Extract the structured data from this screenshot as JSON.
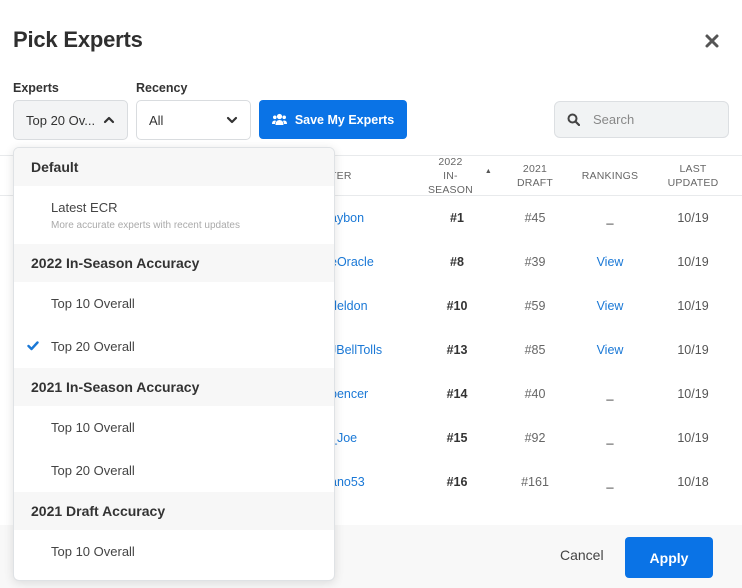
{
  "modal": {
    "title": "Pick Experts",
    "close_icon": "close-icon"
  },
  "filters": {
    "experts_label": "Experts",
    "experts_value": "Top 20 Ov...",
    "recency_label": "Recency",
    "recency_value": "All",
    "save_label": "Save My Experts",
    "search_placeholder": "Search"
  },
  "table": {
    "headers": {
      "name": "TER",
      "insea": [
        "2022",
        "IN-SEASON"
      ],
      "draft": [
        "2021",
        "DRAFT"
      ],
      "rankings": "RANKINGS",
      "updated": [
        "LAST",
        "UPDATED"
      ]
    },
    "rows": [
      {
        "name": "aybon",
        "insea": "#1",
        "draft": "#45",
        "rankings": "_",
        "updated": "10/19"
      },
      {
        "name": "eOracle",
        "insea": "#8",
        "draft": "#39",
        "rankings": "View",
        "updated": "10/19"
      },
      {
        "name": "deldon",
        "insea": "#10",
        "draft": "#59",
        "rankings": "View",
        "updated": "10/19"
      },
      {
        "name": "JBellTolls",
        "insea": "#13",
        "draft": "#85",
        "rankings": "View",
        "updated": "10/19"
      },
      {
        "name": "pencer",
        "insea": "#14",
        "draft": "#40",
        "rankings": "_",
        "updated": "10/19"
      },
      {
        "name": "_Joe",
        "insea": "#15",
        "draft": "#92",
        "rankings": "_",
        "updated": "10/19"
      },
      {
        "name": "ano53",
        "insea": "#16",
        "draft": "#161",
        "rankings": "_",
        "updated": "10/18"
      }
    ]
  },
  "dropdown": {
    "groups": [
      {
        "label": "Default",
        "items": [
          {
            "label": "Latest ECR",
            "sub": "More accurate experts with recent updates"
          }
        ]
      },
      {
        "label": "2022 In-Season Accuracy",
        "items": [
          {
            "label": "Top 10 Overall"
          },
          {
            "label": "Top 20 Overall",
            "selected": true
          }
        ]
      },
      {
        "label": "2021 In-Season Accuracy",
        "items": [
          {
            "label": "Top 10 Overall"
          },
          {
            "label": "Top 20 Overall"
          }
        ]
      },
      {
        "label": "2021 Draft Accuracy",
        "items": [
          {
            "label": "Top 10 Overall"
          }
        ]
      }
    ]
  },
  "footer": {
    "cancel_label": "Cancel",
    "apply_label": "Apply"
  },
  "colors": {
    "accent": "#0a73e6",
    "link": "#1a78d6"
  }
}
